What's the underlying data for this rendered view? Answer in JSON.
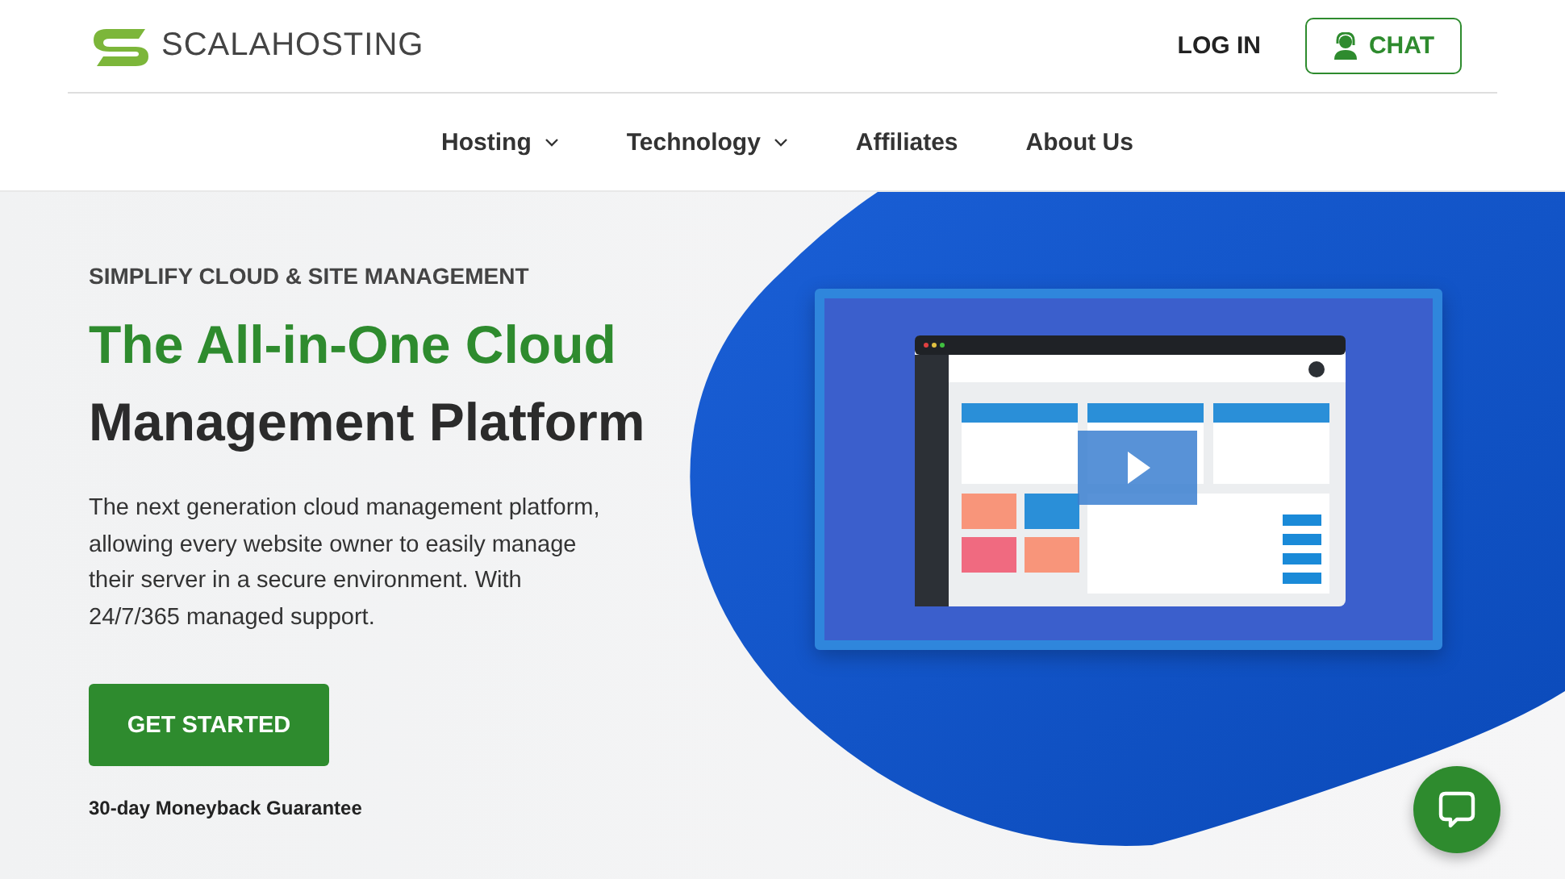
{
  "header": {
    "logo_text": "SCALAHOSTING",
    "login": "LOG IN",
    "chat": "CHAT"
  },
  "nav": [
    {
      "label": "Hosting",
      "has_dropdown": true
    },
    {
      "label": "Technology",
      "has_dropdown": true
    },
    {
      "label": "Affiliates",
      "has_dropdown": false
    },
    {
      "label": "About Us",
      "has_dropdown": false
    }
  ],
  "hero": {
    "eyebrow": "SIMPLIFY CLOUD & SITE MANAGEMENT",
    "title_highlight": "The All-in-One Cloud",
    "title_rest": "Management Platform",
    "description": "The next generation cloud management platform, allowing every website owner to easily manage their server in a secure environment. With 24/7/365 managed support.",
    "cta": "GET STARTED",
    "guarantee": "30-day Moneyback Guarantee"
  }
}
